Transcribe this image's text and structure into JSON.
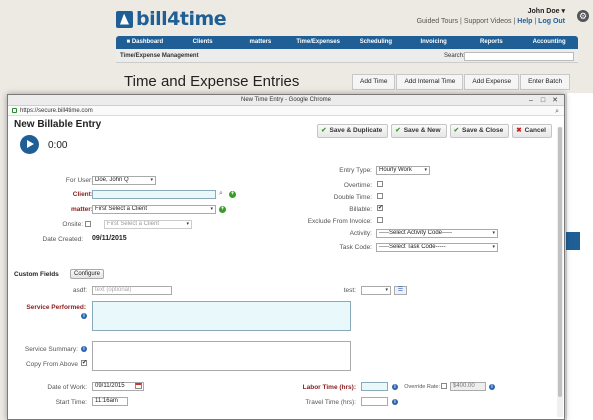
{
  "header": {
    "logo_text": "bill4time",
    "user_name": "John Doe ▾",
    "links": {
      "tours": "Guided Tours",
      "sep1": " | ",
      "videos": "Support Videos",
      "sep2": " | ",
      "help": "Help",
      "sep3": " | ",
      "logout": "Log Out"
    },
    "gear_glyph": "⚙"
  },
  "nav": {
    "items": [
      "■ Dashboard",
      "Clients",
      "matters",
      "Time/Expenses",
      "Scheduling",
      "Invoicing",
      "Reports",
      "Accounting"
    ]
  },
  "subbar": {
    "title": "Time/Expense Management",
    "search_label": "Search:"
  },
  "page": {
    "title": "Time and Expense Entries",
    "actions": [
      "Add Time",
      "Add Internal Time",
      "Add Expense",
      "Enter Batch"
    ]
  },
  "popup": {
    "window_title": "New Time Entry - Google Chrome",
    "window_controls": [
      "–",
      "□",
      "✕"
    ],
    "url": "https://secure.bill4time.com",
    "url_search_glyph": "⌕",
    "entry_title": "New Billable Entry",
    "buttons": {
      "save_duplicate": "Save & Duplicate",
      "save_new": "Save & New",
      "save_close": "Save & Close",
      "cancel": "Cancel"
    },
    "timer": "0:00",
    "left": {
      "for_user_label": "For User:",
      "for_user_value": "Doe, John Q",
      "client_label": "Client:",
      "client_value": "",
      "matter_label": "matter:",
      "matter_value": "First Select a Client",
      "onsite_label": "Onsite:",
      "onsite_value": "First Select a Client",
      "date_created_label": "Date Created:",
      "date_created_value": "09/11/2015"
    },
    "right": {
      "entry_type_label": "Entry Type:",
      "entry_type_value": "Hourly Work",
      "overtime_label": "Overtime:",
      "overtime_checked": false,
      "double_time_label": "Double Time:",
      "double_time_checked": false,
      "billable_label": "Billable:",
      "billable_checked": true,
      "exclude_label": "Exclude From Invoice:",
      "exclude_checked": false,
      "activity_label": "Activity:",
      "activity_value": "-----Select Activity Code-----",
      "task_label": "Task Code:",
      "task_value": "-----Select Task Code-----"
    },
    "custom_fields": {
      "title": "Custom Fields",
      "configure_button": "Configure",
      "asdf_label": "asdf:",
      "asdf_placeholder": "text (optional)",
      "test_label": "test:",
      "test_value": ""
    },
    "service": {
      "performed_label": "Service Performed:",
      "summary_label": "Service Summary:",
      "copy_label": "Copy From Above",
      "copy_checked": true
    },
    "bottom": {
      "date_of_work_label": "Date of Work:",
      "date_of_work_value": "09/11/2015",
      "start_time_label": "Start Time:",
      "start_time_value": "11:16am",
      "labor_time_label": "Labor Time (hrs):",
      "labor_time_value": "",
      "override_rate_label": "Override Rate:",
      "override_rate_checked": false,
      "override_rate_value": "$400.00",
      "travel_time_label": "Travel Time (hrs):",
      "travel_time_value": ""
    },
    "glyphs": {
      "check": "✔",
      "x": "✖",
      "plus": "+",
      "info": "i",
      "mag": "⌕",
      "caret": "▾",
      "checked": "✔",
      "list": "☰"
    }
  },
  "colors": {
    "brand": "#1f5f96",
    "required_label": "#8c1c1c",
    "success": "#3a9a2a",
    "danger": "#c62020"
  }
}
